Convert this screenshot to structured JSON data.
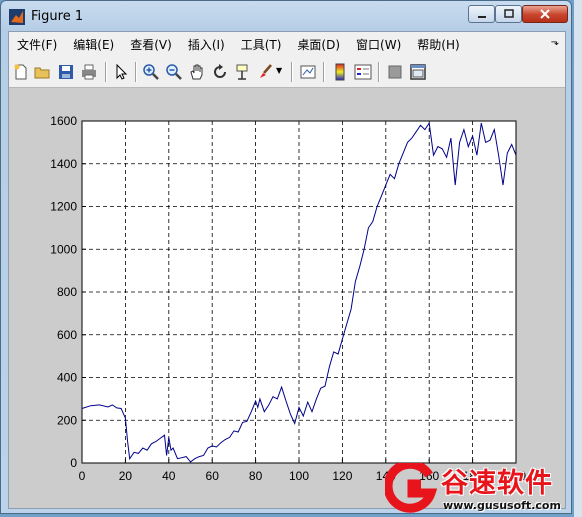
{
  "window": {
    "title": "Figure 1"
  },
  "menu": [
    {
      "label": "文件(F)"
    },
    {
      "label": "编辑(E)"
    },
    {
      "label": "查看(V)"
    },
    {
      "label": "插入(I)"
    },
    {
      "label": "工具(T)"
    },
    {
      "label": "桌面(D)"
    },
    {
      "label": "窗口(W)"
    },
    {
      "label": "帮助(H)"
    }
  ],
  "toolbar": [
    "new-figure-icon",
    "open-file-icon",
    "save-icon",
    "print-icon",
    "pointer-icon",
    "zoom-in-icon",
    "zoom-out-icon",
    "pan-hand-icon",
    "rotate-3d-icon",
    "data-cursor-icon",
    "brush-icon",
    "link-plot-icon",
    "colorbar-icon",
    "legend-icon",
    "hide-plot-tools-icon",
    "show-plot-tools-icon"
  ],
  "watermark": {
    "brand": "谷速软件",
    "url": "www.gususoft.com"
  },
  "chart_data": {
    "type": "line",
    "title": "",
    "xlabel": "",
    "ylabel": "",
    "xlim": [
      0,
      200
    ],
    "ylim": [
      0,
      1600
    ],
    "xticks": [
      0,
      20,
      40,
      60,
      80,
      100,
      120,
      140,
      160,
      180,
      200
    ],
    "yticks": [
      0,
      200,
      400,
      600,
      800,
      1000,
      1200,
      1400,
      1600
    ],
    "grid": "dashed",
    "line_color": "#00008b",
    "series": [
      {
        "x": [
          0,
          4,
          8,
          12,
          14,
          16,
          18,
          20,
          21,
          22,
          23,
          24,
          26,
          28,
          30,
          32,
          34,
          36,
          38,
          39,
          40,
          41,
          42,
          44,
          46,
          48,
          50,
          52,
          54,
          56,
          58,
          60,
          62,
          64,
          66,
          68,
          70,
          72,
          74,
          76,
          78,
          80,
          81,
          82,
          84,
          86,
          88,
          90,
          92,
          94,
          96,
          98,
          100,
          102,
          104,
          106,
          108,
          110,
          112,
          114,
          116,
          118,
          120,
          122,
          124,
          126,
          128,
          130,
          132,
          134,
          136,
          138,
          140,
          142,
          144,
          146,
          148,
          150,
          152,
          154,
          156,
          158,
          160,
          162,
          164,
          166,
          168,
          170,
          172,
          174,
          176,
          178,
          180,
          182,
          184,
          186,
          188,
          190,
          192,
          194,
          196,
          198,
          200
        ],
        "y": [
          255,
          268,
          272,
          262,
          272,
          258,
          255,
          210,
          100,
          20,
          35,
          50,
          45,
          70,
          60,
          90,
          100,
          115,
          130,
          35,
          120,
          60,
          70,
          20,
          25,
          30,
          5,
          20,
          30,
          35,
          70,
          80,
          75,
          95,
          110,
          120,
          150,
          145,
          190,
          195,
          240,
          290,
          260,
          300,
          240,
          270,
          310,
          300,
          355,
          290,
          230,
          185,
          260,
          220,
          285,
          240,
          300,
          350,
          360,
          450,
          520,
          510,
          580,
          650,
          720,
          850,
          920,
          1000,
          1100,
          1130,
          1200,
          1250,
          1300,
          1350,
          1330,
          1400,
          1450,
          1500,
          1520,
          1550,
          1580,
          1560,
          1590,
          1440,
          1480,
          1470,
          1430,
          1520,
          1300,
          1500,
          1560,
          1480,
          1530,
          1440,
          1590,
          1500,
          1510,
          1560,
          1440,
          1300,
          1450,
          1490,
          1440
        ]
      }
    ]
  }
}
